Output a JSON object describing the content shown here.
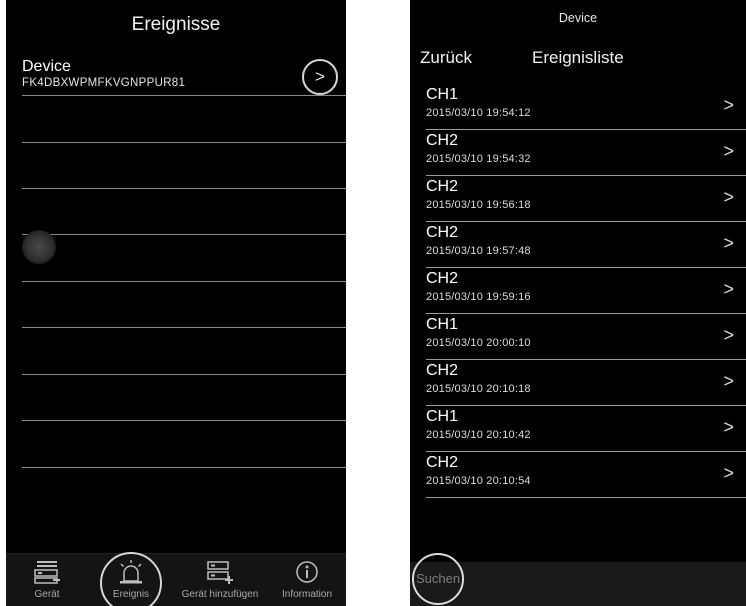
{
  "left": {
    "title": "Ereignisse",
    "device": {
      "name": "Device",
      "id": "FK4DBXWPMFKVGNPPUR81",
      "chevron": ">"
    },
    "tabs": [
      {
        "label": "Gerät",
        "icon": "device-list-icon"
      },
      {
        "label": "Ereignis",
        "icon": "alarm-siren-icon"
      },
      {
        "label": "Gerät hinzufügen",
        "icon": "add-device-icon"
      },
      {
        "label": "Information",
        "icon": "info-icon"
      }
    ]
  },
  "right": {
    "header": "Device",
    "back": "Zurück",
    "title": "Ereignisliste",
    "events": [
      {
        "channel": "CH1",
        "timestamp": "2015/03/10 19:54:12"
      },
      {
        "channel": "CH2",
        "timestamp": "2015/03/10 19:54:32"
      },
      {
        "channel": "CH2",
        "timestamp": "2015/03/10 19:56:18"
      },
      {
        "channel": "CH2",
        "timestamp": "2015/03/10 19:57:48"
      },
      {
        "channel": "CH2",
        "timestamp": "2015/03/10 19:59:16"
      },
      {
        "channel": "CH1",
        "timestamp": "2015/03/10 20:00:10"
      },
      {
        "channel": "CH2",
        "timestamp": "2015/03/10 20:10:18"
      },
      {
        "channel": "CH1",
        "timestamp": "2015/03/10 20:10:42"
      },
      {
        "channel": "CH2",
        "timestamp": "2015/03/10 20:10:54"
      }
    ],
    "chevron": ">",
    "search": "Suchen"
  }
}
